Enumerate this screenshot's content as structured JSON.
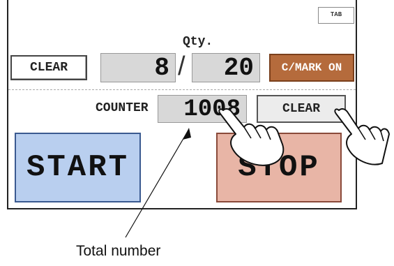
{
  "panel": {
    "tab_label": "TAB",
    "clear_label": "CLEAR",
    "lot_value": "8",
    "slash": "/",
    "qty_label": "Qty.",
    "qty_value": "20",
    "cmark_label": "C/MARK ON",
    "counter_label": "COUNTER",
    "counter_value": "1008",
    "counter_clear_label": "CLEAR",
    "start_label": "START",
    "stop_label": "STOP"
  },
  "annotation": {
    "caption": "Total number"
  },
  "colors": {
    "cmark_bg": "#b56b3c",
    "start_bg": "#b9cfef",
    "stop_bg": "#e8b5a6",
    "display_bg": "#d8d8d8"
  },
  "icons": [
    "pointing-hand-icon",
    "pointing-hand-icon"
  ]
}
